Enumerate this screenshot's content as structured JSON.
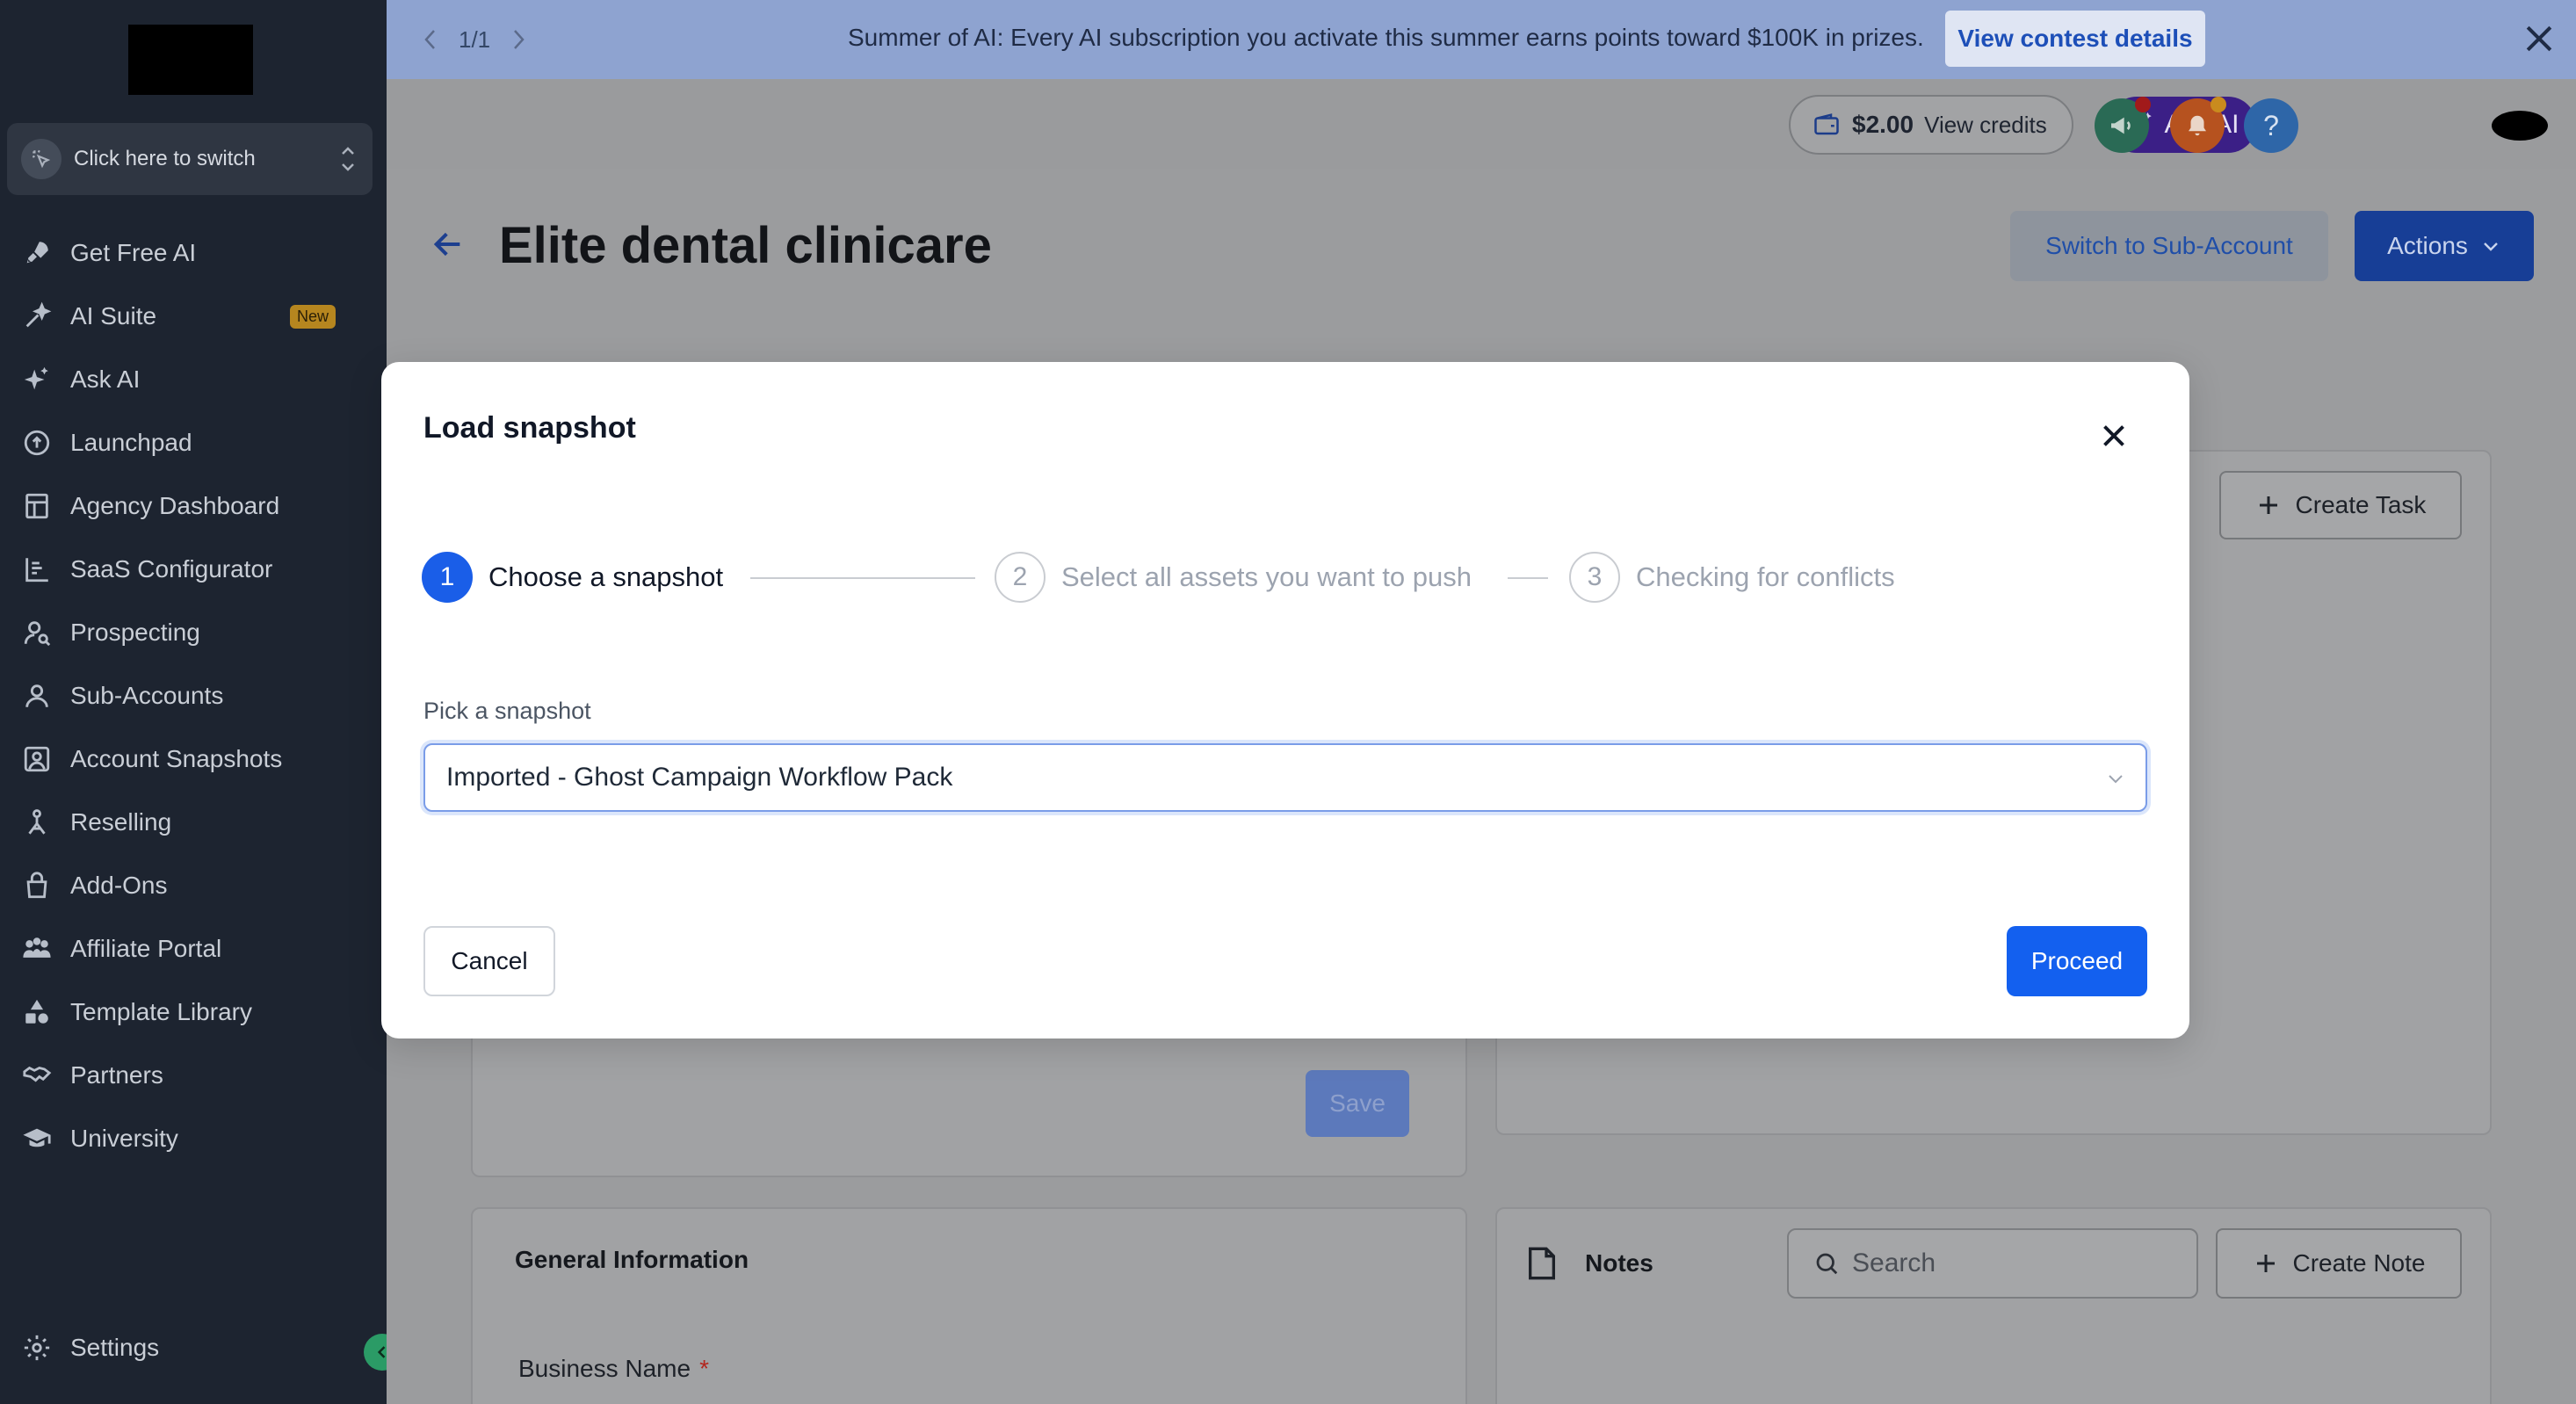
{
  "sidebar": {
    "switcher_label": "Click here to switch",
    "items": [
      {
        "label": "Get Free AI",
        "icon": "rocket-icon"
      },
      {
        "label": "AI Suite",
        "icon": "sparkle-wand-icon",
        "badge": "New"
      },
      {
        "label": "Ask AI",
        "icon": "sparkles-icon"
      },
      {
        "label": "Launchpad",
        "icon": "launchpad-icon"
      },
      {
        "label": "Agency Dashboard",
        "icon": "dashboard-icon"
      },
      {
        "label": "SaaS Configurator",
        "icon": "chart-icon"
      },
      {
        "label": "Prospecting",
        "icon": "person-search-icon"
      },
      {
        "label": "Sub-Accounts",
        "icon": "user-icon"
      },
      {
        "label": "Account Snapshots",
        "icon": "snapshot-icon"
      },
      {
        "label": "Reselling",
        "icon": "reselling-icon"
      },
      {
        "label": "Add-Ons",
        "icon": "bag-icon"
      },
      {
        "label": "Affiliate Portal",
        "icon": "users-icon"
      },
      {
        "label": "Template Library",
        "icon": "shapes-icon"
      },
      {
        "label": "Partners",
        "icon": "handshake-icon"
      },
      {
        "label": "University",
        "icon": "graduation-cap-icon"
      }
    ],
    "settings_label": "Settings"
  },
  "banner": {
    "pager": "1/1",
    "message": "Summer of AI: Every AI subscription you activate this summer earns points toward $100K in prizes.",
    "cta": "View contest details"
  },
  "topbar": {
    "credits_amount": "$2.00",
    "credits_label": "View credits",
    "ask_ai": "Ask AI"
  },
  "page": {
    "title": "Elite dental clinicare",
    "switch_sub_account": "Switch to Sub-Account",
    "actions": "Actions",
    "create_task": "Create Task",
    "save": "Save",
    "general_information": "General Information",
    "business_name_label": "Business Name",
    "required_mark": "*",
    "notes_title": "Notes",
    "notes_search_placeholder": "Search",
    "create_note": "Create Note"
  },
  "modal": {
    "title": "Load snapshot",
    "steps": [
      {
        "number": "1",
        "label": "Choose a snapshot"
      },
      {
        "number": "2",
        "label": "Select all assets you want to push"
      },
      {
        "number": "3",
        "label": "Checking for conflicts"
      }
    ],
    "pick_label": "Pick a snapshot",
    "selected_snapshot": "Imported - Ghost Campaign Workflow Pack",
    "cancel": "Cancel",
    "proceed": "Proceed"
  },
  "colors": {
    "sidebar_bg": "#1d2430",
    "banner_bg": "#8ea3d0",
    "primary": "#1360ef",
    "ask_ai_bg": "#3b1f86"
  }
}
